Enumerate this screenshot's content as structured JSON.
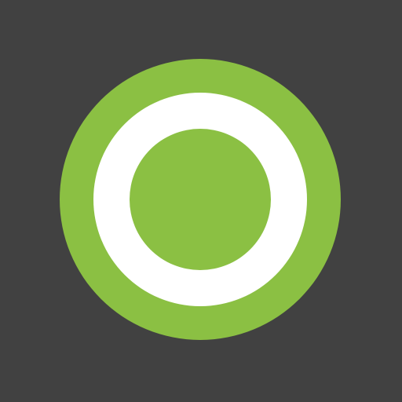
{
  "app_icon": {
    "icon_name": "radio-button-checked-icon",
    "colors": {
      "background": "#414141",
      "outer_ring": "#8bc043",
      "inner_ring": "#ffffff",
      "center_dot": "#8bc043"
    }
  }
}
